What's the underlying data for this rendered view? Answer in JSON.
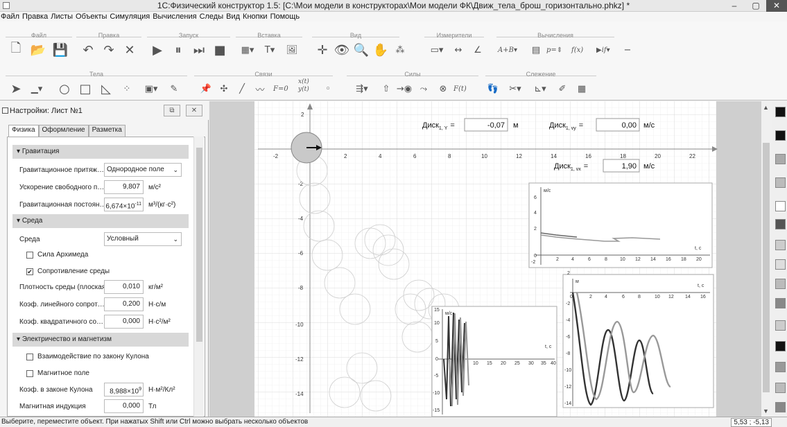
{
  "window": {
    "title": "1С:Физический конструктор 1.5: [C:\\Мои модели в конструкторах\\Мои модели ФК\\Движ_тела_брош_горизонтально.phkz] *",
    "min": "–",
    "max": "▢",
    "close": "✕"
  },
  "menu": [
    "Файл",
    "Правка",
    "Листы",
    "Объекты",
    "Симуляция",
    "Вычисления",
    "Следы",
    "Вид",
    "Кнопки",
    "Помощь"
  ],
  "ribbon": {
    "groups": {
      "file": "Файл",
      "edit": "Правка",
      "run": "Запуск",
      "insert": "Вставка",
      "view": "Вид",
      "meters": "Измерители",
      "calc": "Вычисления",
      "bodies": "Тела",
      "links": "Связи",
      "forces": "Силы",
      "trace": "Слежение"
    },
    "calc_items": {
      "ab": "A+B",
      "p": "p=",
      "fx": "f(x)",
      "if": "if"
    },
    "link_items": {
      "f0": "F=0",
      "xt": "x(t)",
      "yt": "y(t)",
      "ft": "F(t)"
    }
  },
  "panel": {
    "title": "Настройки: Лист №1",
    "tabs": [
      "Физика",
      "Оформление",
      "Разметка"
    ],
    "sections": {
      "gravity": "Гравитация",
      "medium": "Среда",
      "em": "Электричество и магнетизм"
    },
    "rows": {
      "grav_attr": {
        "label": "Гравитационное притяж…",
        "value": "Однородное поле"
      },
      "g": {
        "label": "Ускорение свободного п…",
        "value": "9,807",
        "unit": "м/с²"
      },
      "G": {
        "label": "Гравитационная постоян…",
        "value": "6,674×10",
        "exp": "-11",
        "unit": "м³/(кг·с²)"
      },
      "medium": {
        "label": "Среда",
        "value": "Условный"
      },
      "archimedes": {
        "label": "Сила Архимеда",
        "checked": false
      },
      "resistance": {
        "label": "Сопротивление среды",
        "checked": true
      },
      "density": {
        "label": "Плотность среды (плоская)",
        "value": "0,010",
        "unit": "кг/м²"
      },
      "linear": {
        "label": "Коэф. линейного сопрот…",
        "value": "0,200",
        "unit": "Н·с/м"
      },
      "quadratic": {
        "label": "Коэф. квадратичного со…",
        "value": "0,000",
        "unit": "Н·с²/м²"
      },
      "coulomb": {
        "label": "Взаимодействие по закону Кулона",
        "checked": false
      },
      "magnetic": {
        "label": "Магнитное поле",
        "checked": false
      },
      "k": {
        "label": "Коэф. в законе Кулона",
        "value": "8,988×10",
        "exp": "9",
        "unit": "Н·м²/Кл²"
      },
      "B": {
        "label": "Магнитная индукция",
        "value": "0,000",
        "unit": "Тл"
      }
    }
  },
  "canvas": {
    "meters": {
      "y": {
        "label": "Диск",
        "sub": "1, Y",
        "eq": "=",
        "value": "-0,07",
        "unit": "м"
      },
      "vy": {
        "label": "Диск",
        "sub": "1, vy",
        "eq": "=",
        "value": "0,00",
        "unit": "м/с"
      },
      "vx": {
        "label": "Диск",
        "sub": "1, vx",
        "eq": "=",
        "value": "1,90",
        "unit": "м/с"
      }
    },
    "x_ticks": [
      "-2",
      "2",
      "4",
      "6",
      "8",
      "10",
      "12",
      "14",
      "16",
      "18",
      "20",
      "22"
    ],
    "y_ticks": [
      "2",
      "-2",
      "-4",
      "-6",
      "-8",
      "-10",
      "-12",
      "-14"
    ],
    "graph1": {
      "ylabel": "м/с",
      "xlabel": "t, с",
      "yt": [
        "6",
        "4",
        "2",
        "0",
        "-2"
      ],
      "xt": [
        "2",
        "4",
        "6",
        "8",
        "10",
        "12",
        "14",
        "16",
        "18",
        "20"
      ]
    },
    "graph2": {
      "ylabel": "м",
      "xlabel": "t, с",
      "yt": [
        "2",
        "-2",
        "-4",
        "-6",
        "-8",
        "-10",
        "-12",
        "-14"
      ],
      "xt": [
        "0",
        "2",
        "4",
        "6",
        "8",
        "10",
        "12",
        "14",
        "16"
      ]
    },
    "graph3": {
      "ylabel": "м/с",
      "xlabel": "t, с",
      "yt": [
        "15",
        "10",
        "5",
        "0",
        "-5",
        "-10",
        "-15"
      ],
      "xt": [
        "10",
        "15",
        "20",
        "25",
        "30",
        "35",
        "40"
      ]
    }
  },
  "status": {
    "text": "Выберите, переместите объект. При нажатых Shift или Ctrl можно выбрать несколько объектов",
    "coords": "5,53 ; -5,13"
  }
}
